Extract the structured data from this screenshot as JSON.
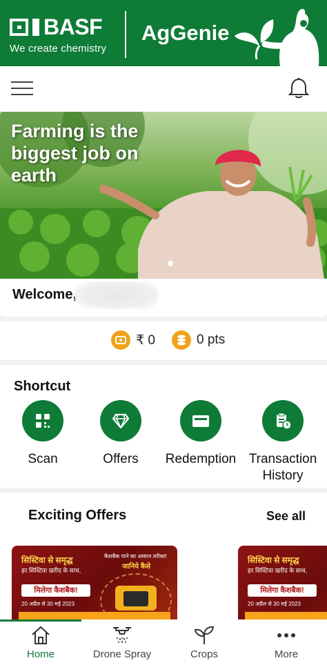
{
  "header": {
    "brand": "BASF",
    "tagline": "We create chemistry",
    "app_name": "AgGenie"
  },
  "hero": {
    "title": "Farming is the biggest job on earth"
  },
  "welcome": {
    "label": "Welcome,"
  },
  "balance": {
    "cash": "₹ 0",
    "points": "0 pts"
  },
  "shortcut": {
    "title": "Shortcut",
    "items": [
      {
        "label": "Scan",
        "icon": "qr-scan-icon"
      },
      {
        "label": "Offers",
        "icon": "diamond-icon"
      },
      {
        "label": "Redemption",
        "icon": "wallet-icon"
      },
      {
        "label": "Transaction History",
        "icon": "clipboard-clock-icon"
      }
    ]
  },
  "offers": {
    "title": "Exciting Offers",
    "see_all": "See all",
    "cards": [
      {
        "headline": "सिस्टिवा से समृद्ध",
        "sub": "हर सिस्टिवा खरीद के साथ,",
        "cashback": "मिलेगा कैशबैक!",
        "dates": "20 अप्रैल से 30 मई 2023",
        "right_top": "कैशबैक पाने का आसान तरीका!",
        "right_title": "जानिये कैसे"
      },
      {
        "headline": "सिस्टिवा से समृद्ध",
        "sub": "हर सिस्टिवा खरीद के साथ,",
        "cashback": "मिलेगा कैशबैक!",
        "dates": "20 अप्रैल से 30 मई 2023"
      }
    ]
  },
  "bottom_nav": {
    "items": [
      {
        "label": "Home",
        "icon": "home-icon",
        "active": true
      },
      {
        "label": "Drone Spray",
        "icon": "drone-icon"
      },
      {
        "label": "Crops",
        "icon": "sprout-icon"
      },
      {
        "label": "More",
        "icon": "more-dots-icon"
      }
    ]
  },
  "colors": {
    "brand_green": "#0e7b37",
    "coin_orange": "#f0a21a"
  }
}
